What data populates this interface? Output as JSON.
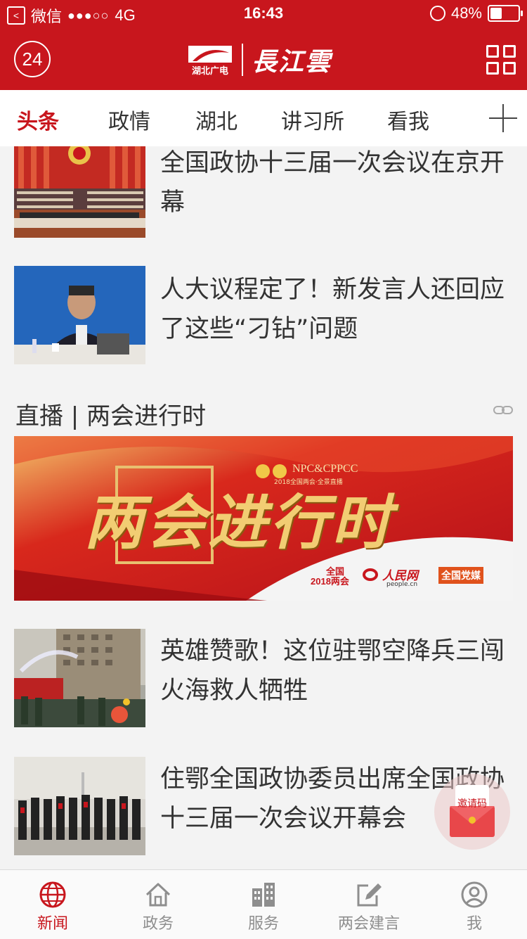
{
  "status_bar": {
    "carrier": "微信",
    "signal": "●●●○○",
    "network": "4G",
    "time": "16:43",
    "battery": "48%",
    "battery_level": 0.48
  },
  "app_bar": {
    "badge": "24",
    "logo_sub": "湖北广电",
    "logo_text": "長江雲"
  },
  "tabs": [
    {
      "label": "头条",
      "active": true
    },
    {
      "label": "政情",
      "active": false
    },
    {
      "label": "湖北",
      "active": false
    },
    {
      "label": "讲习所",
      "active": false
    },
    {
      "label": "看我",
      "active": false
    }
  ],
  "feed": {
    "items": [
      {
        "title": "全国政协十三届一次会议在京开幕"
      },
      {
        "title": "人大议程定了！新发言人还回应了这些“刁钻”问题"
      }
    ],
    "live": {
      "header": "直播 | 两会进行时",
      "banner": {
        "headline": "两会进行时",
        "tag": "NPC&CPPCC",
        "sub": "2018全国两会·全景直播",
        "logo1_top": "全国",
        "logo1_year": "2018",
        "logo1_bottom": "两会",
        "logo2": "人民网",
        "logo2_sub": "people.cn",
        "logo3": "全国党媒"
      }
    },
    "items2": [
      {
        "title": "英雄赞歌！这位驻鄂空降兵三闯火海救人牺牲"
      },
      {
        "title": "住鄂全国政协委员出席全国政协十三届一次会议开幕会"
      }
    ]
  },
  "fab": {
    "label": "邀请码"
  },
  "bottom_nav": [
    {
      "label": "新闻",
      "icon": "globe-icon",
      "active": true
    },
    {
      "label": "政务",
      "icon": "home-icon",
      "active": false
    },
    {
      "label": "服务",
      "icon": "building-icon",
      "active": false
    },
    {
      "label": "两会建言",
      "icon": "edit-icon",
      "active": false
    },
    {
      "label": "我",
      "icon": "profile-icon",
      "active": false
    }
  ],
  "colors": {
    "brand": "#c8161d",
    "background": "#f3f3f3",
    "inactive": "#8e8e8e"
  }
}
